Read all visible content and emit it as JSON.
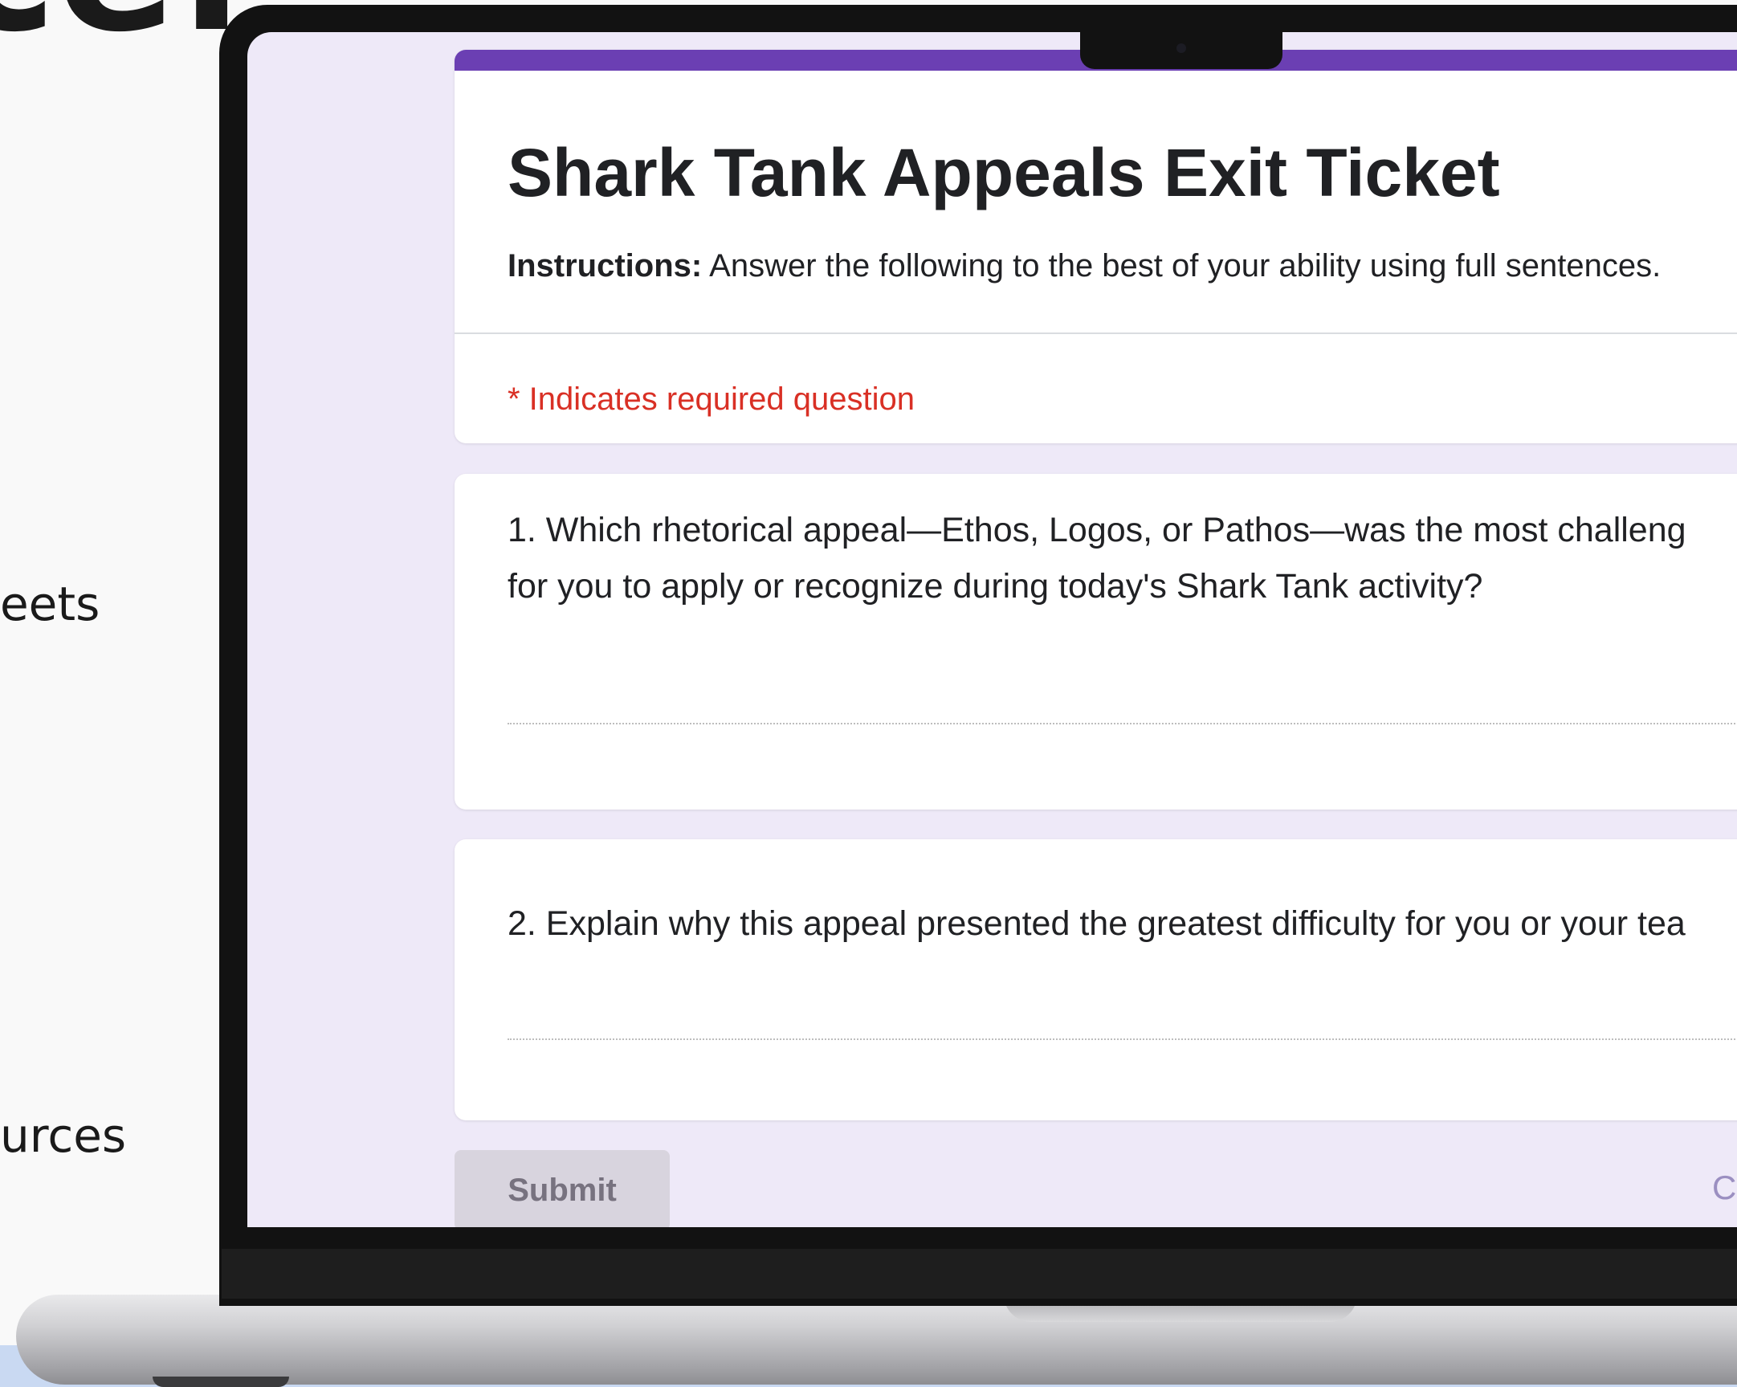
{
  "background": {
    "heading_fragment": "ce:",
    "side_text_1": "eets",
    "side_text_2": "urces"
  },
  "colors": {
    "accent": "#6b3fb3",
    "page_background": "#eee9f8",
    "required": "#d93025",
    "submit_background": "#d8d4de",
    "clear_form": "#9b8fc1"
  },
  "form": {
    "title": "Shark Tank Appeals Exit Ticket",
    "instructions_label": "Instructions:",
    "instructions_text": " Answer the following to the best of your ability using full sentences.",
    "required_note": "* Indicates required question",
    "questions": [
      {
        "lines": [
          "1. Which rhetorical appeal—Ethos, Logos, or Pathos—was the most challeng",
          "for you to apply or recognize during today's Shark Tank activity?"
        ],
        "answer_value": ""
      },
      {
        "lines": [
          "2. Explain why this appeal presented the greatest difficulty for you or your tea"
        ],
        "answer_value": ""
      }
    ],
    "submit_label": "Submit",
    "clear_label": "C"
  }
}
